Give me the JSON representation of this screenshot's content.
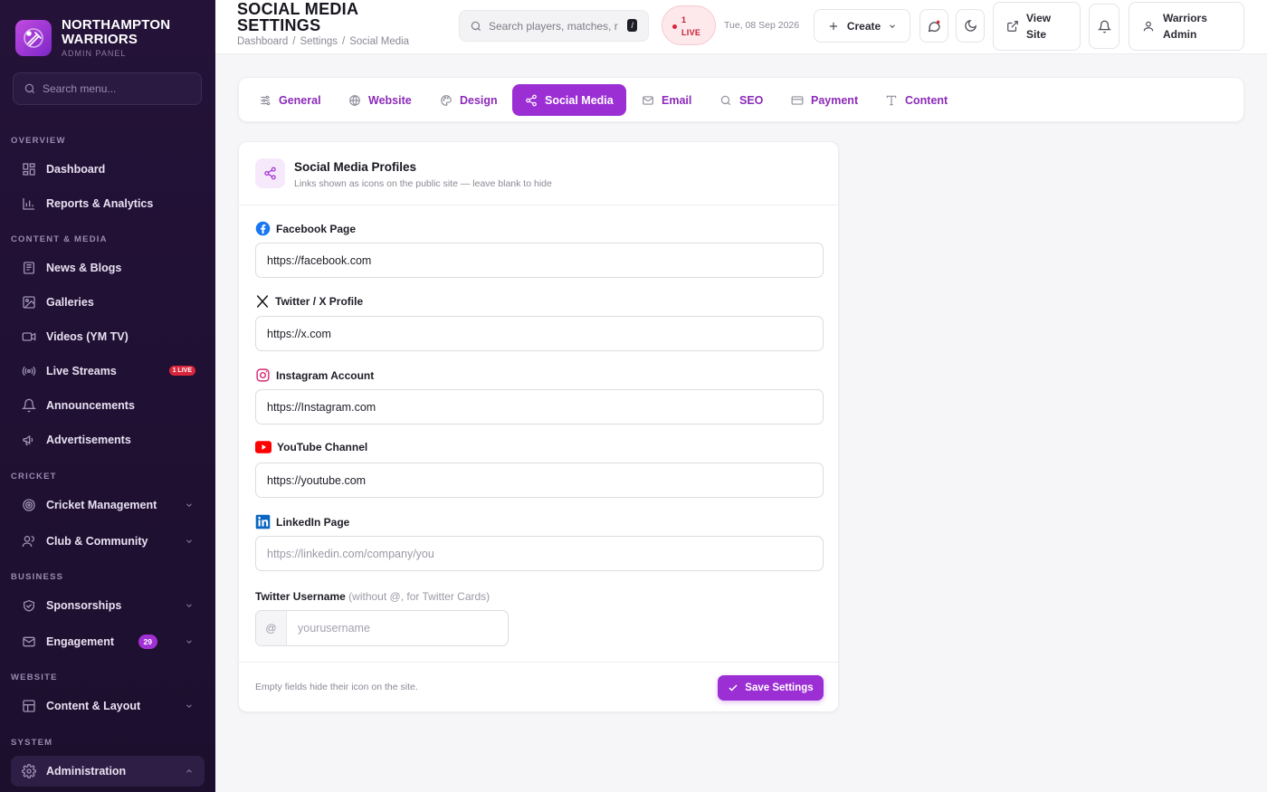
{
  "brand": {
    "name": "NORTHAMPTON WARRIORS",
    "subtitle": "ADMIN PANEL"
  },
  "sidebar": {
    "search_placeholder": "Search menu...",
    "sections": {
      "overview": "OVERVIEW",
      "content_media": "CONTENT & MEDIA",
      "cricket": "CRICKET",
      "business": "BUSINESS",
      "website": "WEBSITE",
      "system": "SYSTEM"
    },
    "items": {
      "dashboard": "Dashboard",
      "reports": "Reports & Analytics",
      "news": "News & Blogs",
      "galleries": "Galleries",
      "videos": "Videos (YM TV)",
      "live_streams": "Live Streams",
      "live_badge": "1 LIVE",
      "announcements": "Announcements",
      "advertisements": "Advertisements",
      "cricket_mgmt": "Cricket Management",
      "club": "Club & Community",
      "sponsorships": "Sponsorships",
      "engagement": "Engagement",
      "engagement_count": "29",
      "content_layout": "Content & Layout",
      "administration": "Administration"
    }
  },
  "topbar": {
    "title": "SOCIAL MEDIA SETTINGS",
    "breadcrumb": [
      "Dashboard",
      "/",
      "Settings",
      "/",
      "Social Media"
    ],
    "search_placeholder": "Search players, matches, r",
    "search_shortcut": "/",
    "live_count": "1",
    "live_label": "LIVE",
    "date": "Tue, 08 Sep 2026",
    "create_label": "Create",
    "view_site_line1": "View",
    "view_site_line2": "Site",
    "user_line1": "Warriors",
    "user_line2": "Admin"
  },
  "tabs": [
    "General",
    "Website",
    "Design",
    "Social Media",
    "Email",
    "SEO",
    "Payment",
    "Content"
  ],
  "active_tab": "Social Media",
  "card": {
    "title": "Social Media Profiles",
    "subtitle": "Links shown as icons on the public site — leave blank to hide",
    "fields": [
      {
        "label": "Facebook Page",
        "value": "https://facebook.com",
        "placeholder": ""
      },
      {
        "label": "Twitter / X Profile",
        "value": "https://x.com",
        "placeholder": ""
      },
      {
        "label": "Instagram Account",
        "value": "https://Instagram.com",
        "placeholder": ""
      },
      {
        "label": "YouTube Channel",
        "value": "https://youtube.com",
        "placeholder": ""
      },
      {
        "label": "LinkedIn Page",
        "value": "",
        "placeholder": "https://linkedin.com/company/you"
      }
    ],
    "username_label": "Twitter Username",
    "username_hint": "(without @, for Twitter Cards)",
    "username_prefix": "@",
    "username_placeholder": "yourusername",
    "footer_note": "Empty fields hide their icon on the site.",
    "save_label": "Save Settings"
  },
  "colors": {
    "accent": "#9b2fd4",
    "sidebar_bg": "#241238",
    "live": "#d9263b"
  }
}
